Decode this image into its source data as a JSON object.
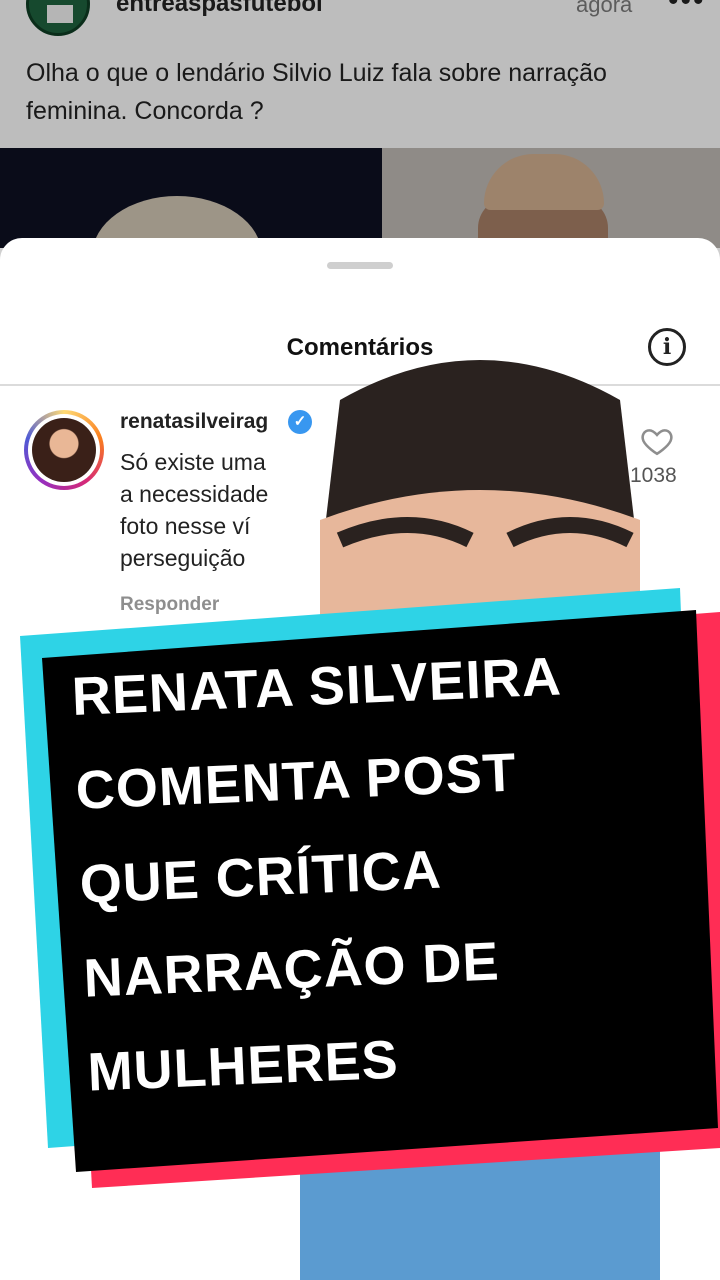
{
  "post": {
    "username": "entreaspasfutebol",
    "time": "agora",
    "more_label": "•••",
    "caption": "Olha o que o lendário Silvio Luiz fala sobre narração feminina. Concorda ?"
  },
  "comments_sheet": {
    "title": "Comentários",
    "info_label": "i",
    "comment": {
      "username": "renatasilveirag",
      "verified_mark": "✓",
      "text_lines": [
        "Só existe uma",
        "a necessidade",
        "foto nesse ví",
        "perseguição"
      ],
      "reply_label": "Responder",
      "likes": "1038"
    }
  },
  "headline": {
    "lines": [
      "RENATA SILVEIRA",
      "COMENTA POST",
      "QUE CRÍTICA",
      "NARRAÇÃO DE",
      "MULHERES"
    ],
    "colors": {
      "box": "#000000",
      "accent_left": "#2ed3e6",
      "accent_right": "#ff2d55",
      "text": "#ffffff"
    }
  }
}
